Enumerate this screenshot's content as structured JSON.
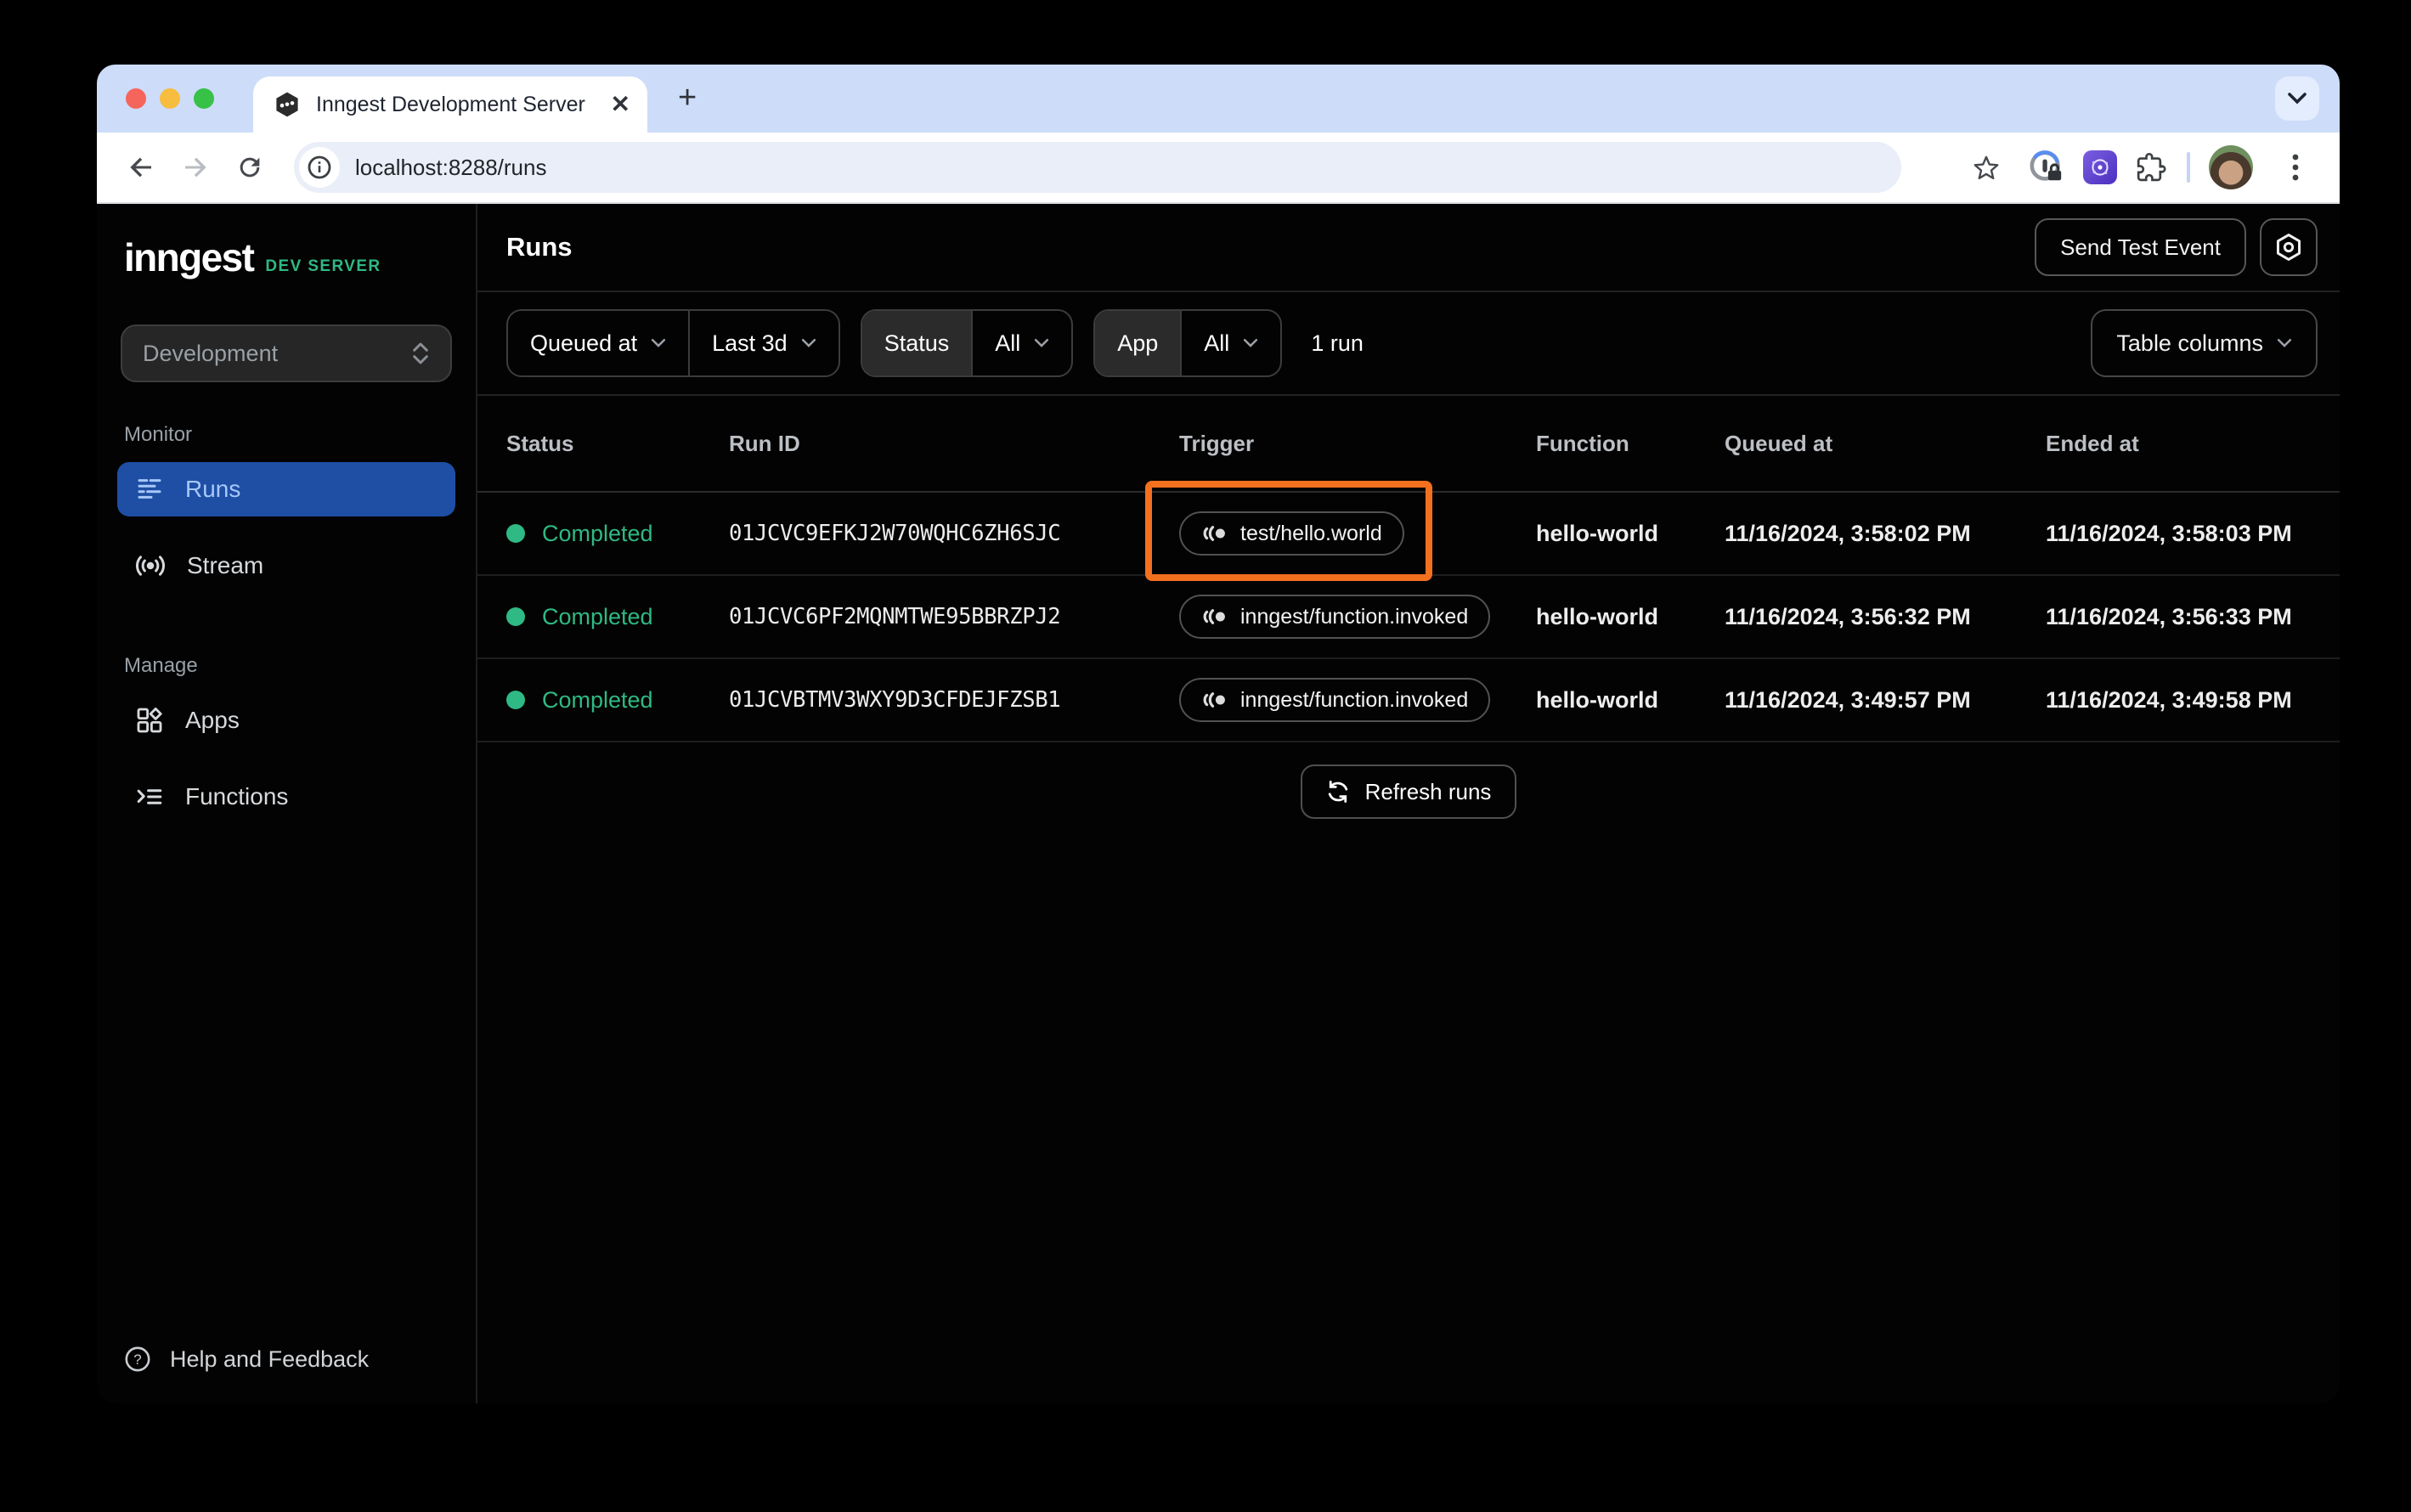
{
  "browser": {
    "tab_title": "Inngest Development Server",
    "new_tab_label": "+",
    "close_label": "✕",
    "url": "localhost:8288/runs"
  },
  "sidebar": {
    "logo": "inngest",
    "badge": "DEV SERVER",
    "environment": "Development",
    "monitor_label": "Monitor",
    "manage_label": "Manage",
    "items": {
      "runs": "Runs",
      "stream": "Stream",
      "apps": "Apps",
      "functions": "Functions"
    },
    "help": "Help and Feedback"
  },
  "header": {
    "title": "Runs",
    "send_test_event": "Send Test Event"
  },
  "filters": {
    "queued_at": "Queued at",
    "time_range": "Last 3d",
    "status_label": "Status",
    "status_value": "All",
    "app_label": "App",
    "app_value": "All",
    "run_count": "1 run",
    "table_columns": "Table columns"
  },
  "table": {
    "columns": [
      "Status",
      "Run ID",
      "Trigger",
      "Function",
      "Queued at",
      "Ended at"
    ],
    "rows": [
      {
        "status": "Completed",
        "run_id": "01JCVC9EFKJ2W70WQHC6ZH6SJC",
        "trigger": "test/hello.world",
        "function": "hello-world",
        "queued_at": "11/16/2024, 3:58:02 PM",
        "ended_at": "11/16/2024, 3:58:03 PM"
      },
      {
        "status": "Completed",
        "run_id": "01JCVC6PF2MQNMTWE95BBRZPJ2",
        "trigger": "inngest/function.invoked",
        "function": "hello-world",
        "queued_at": "11/16/2024, 3:56:32 PM",
        "ended_at": "11/16/2024, 3:56:33 PM"
      },
      {
        "status": "Completed",
        "run_id": "01JCVBTMV3WXY9D3CFDEJFZSB1",
        "trigger": "inngest/function.invoked",
        "function": "hello-world",
        "queued_at": "11/16/2024, 3:49:57 PM",
        "ended_at": "11/16/2024, 3:49:58 PM"
      }
    ]
  },
  "refresh_label": "Refresh runs",
  "colors": {
    "accent_green": "#2fb984",
    "selected_blue": "#1e4fa5",
    "highlight_orange": "#f3701e",
    "tabstrip": "#cddcf9"
  }
}
